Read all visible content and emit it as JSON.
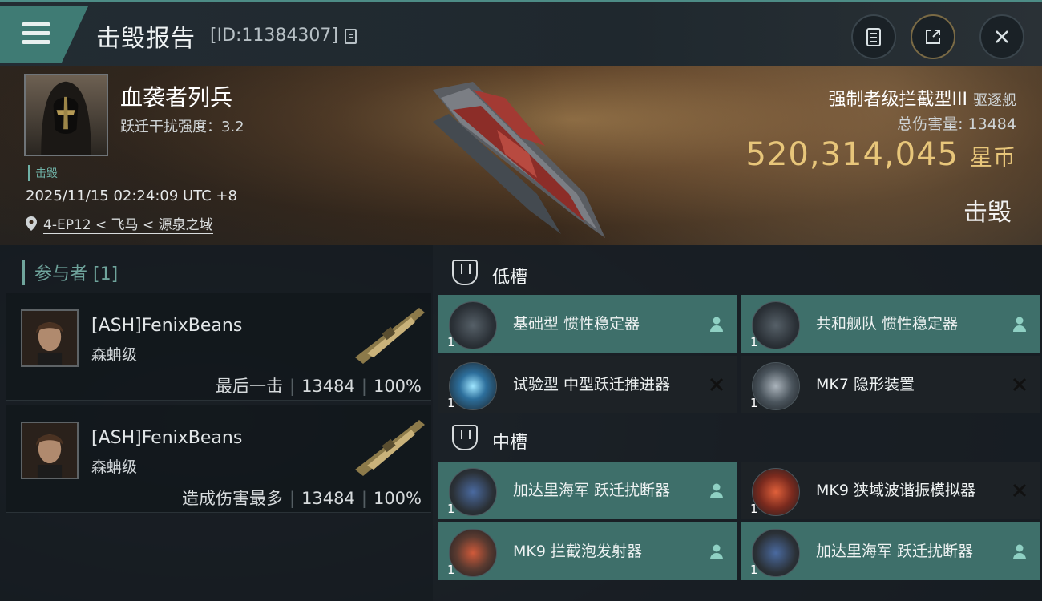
{
  "header": {
    "title": "击毁报告",
    "report_id": "[ID:11384307]"
  },
  "victim": {
    "pilot_name": "血袭者列兵",
    "scram_strength": "跃迁干扰强度：3.2",
    "tag": "击毁",
    "datetime": "2025/11/15 02:24:09 UTC +8",
    "location": "4-EP12 < 飞马 < 源泉之域"
  },
  "ship": {
    "name": "强制者级拦截型III",
    "class": "驱逐舰",
    "total_damage_label": "总伤害量:",
    "total_damage": "13484",
    "isk_value": "520,314,045",
    "currency": "星币",
    "status": "击毁"
  },
  "participants": {
    "header": "参与者 [1]",
    "rows": [
      {
        "name": "[ASH]FenixBeans",
        "ship": "森蚺级",
        "label": "最后一击",
        "damage": "13484",
        "percent": "100%"
      },
      {
        "name": "[ASH]FenixBeans",
        "ship": "森蚺级",
        "label": "造成伤害最多",
        "damage": "13484",
        "percent": "100%"
      }
    ]
  },
  "slots": {
    "low_title": "低槽",
    "mid_title": "中槽",
    "low": [
      {
        "name": "基础型 惯性稳定器",
        "qty": "1",
        "state": "fitted"
      },
      {
        "name": "共和舰队 惯性稳定器",
        "qty": "1",
        "state": "fitted"
      },
      {
        "name": "试验型 中型跃迁推进器",
        "qty": "1",
        "state": "destroyed"
      },
      {
        "name": "MK7 隐形装置",
        "qty": "1",
        "state": "destroyed"
      }
    ],
    "mid": [
      {
        "name": "加达里海军 跃迁扰断器",
        "qty": "1",
        "state": "fitted"
      },
      {
        "name": "MK9 狭域波谐振模拟器",
        "qty": "1",
        "state": "destroyed"
      },
      {
        "name": "MK9 拦截泡发射器",
        "qty": "1",
        "state": "fitted"
      },
      {
        "name": "加达里海军 跃迁扰断器",
        "qty": "1",
        "state": "fitted"
      }
    ]
  },
  "colors": {
    "accent": "#3e6f6a",
    "isk": "#e8c67a",
    "dark_slot": "#1d2226"
  }
}
